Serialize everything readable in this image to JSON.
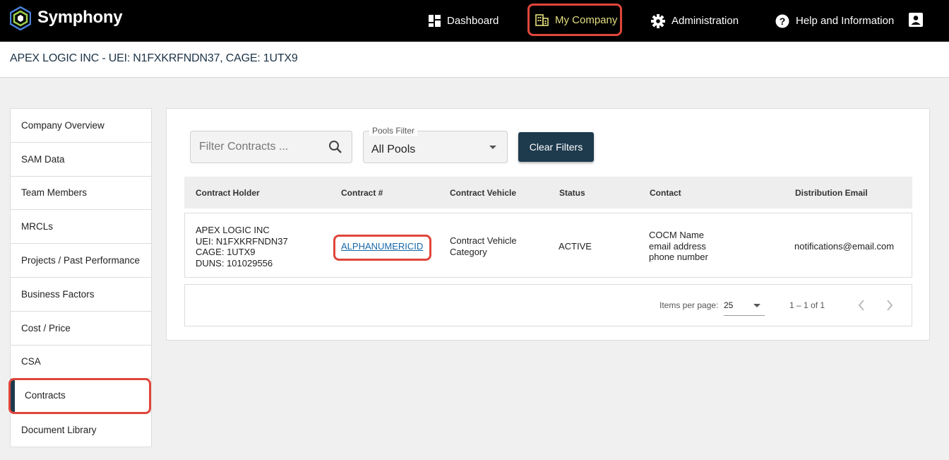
{
  "brand": "Symphony",
  "nav": {
    "dashboard": "Dashboard",
    "my_company": "My Company",
    "administration": "Administration",
    "help": "Help and Information"
  },
  "company_title": "APEX LOGIC INC - UEI: N1FXKRFNDN37, CAGE: 1UTX9",
  "sidebar": {
    "items": [
      {
        "label": "Company Overview"
      },
      {
        "label": "SAM Data"
      },
      {
        "label": "Team Members"
      },
      {
        "label": "MRCLs"
      },
      {
        "label": "Projects / Past Performance"
      },
      {
        "label": "Business Factors"
      },
      {
        "label": "Cost / Price"
      },
      {
        "label": "CSA"
      },
      {
        "label": "Contracts"
      },
      {
        "label": "Document Library"
      }
    ],
    "active": "Contracts"
  },
  "filters": {
    "search_placeholder": "Filter Contracts ...",
    "pools_label": "Pools Filter",
    "pools_value": "All Pools",
    "clear_label": "Clear Filters"
  },
  "table": {
    "headers": [
      "Contract Holder",
      "Contract #",
      "Contract Vehicle",
      "Status",
      "Contact",
      "Distribution Email"
    ],
    "rows": [
      {
        "holder": [
          "APEX LOGIC INC",
          "UEI: N1FXKRFNDN37",
          "CAGE: 1UTX9",
          "DUNS: 101029556"
        ],
        "contract_no": "ALPHANUMERICID",
        "vehicle": [
          "Contract Vehicle",
          "Category"
        ],
        "status": "ACTIVE",
        "contact": [
          "COCM Name",
          "email address",
          "phone number"
        ],
        "email": "notifications@email.com"
      }
    ]
  },
  "pager": {
    "items_per_page_label": "Items per page:",
    "items_per_page": "25",
    "range": "1 – 1 of 1"
  },
  "colors": {
    "accent": "#1e3a4d",
    "highlight": "#e0463a",
    "nav_active": "#e6df80",
    "link": "#1768a8"
  }
}
